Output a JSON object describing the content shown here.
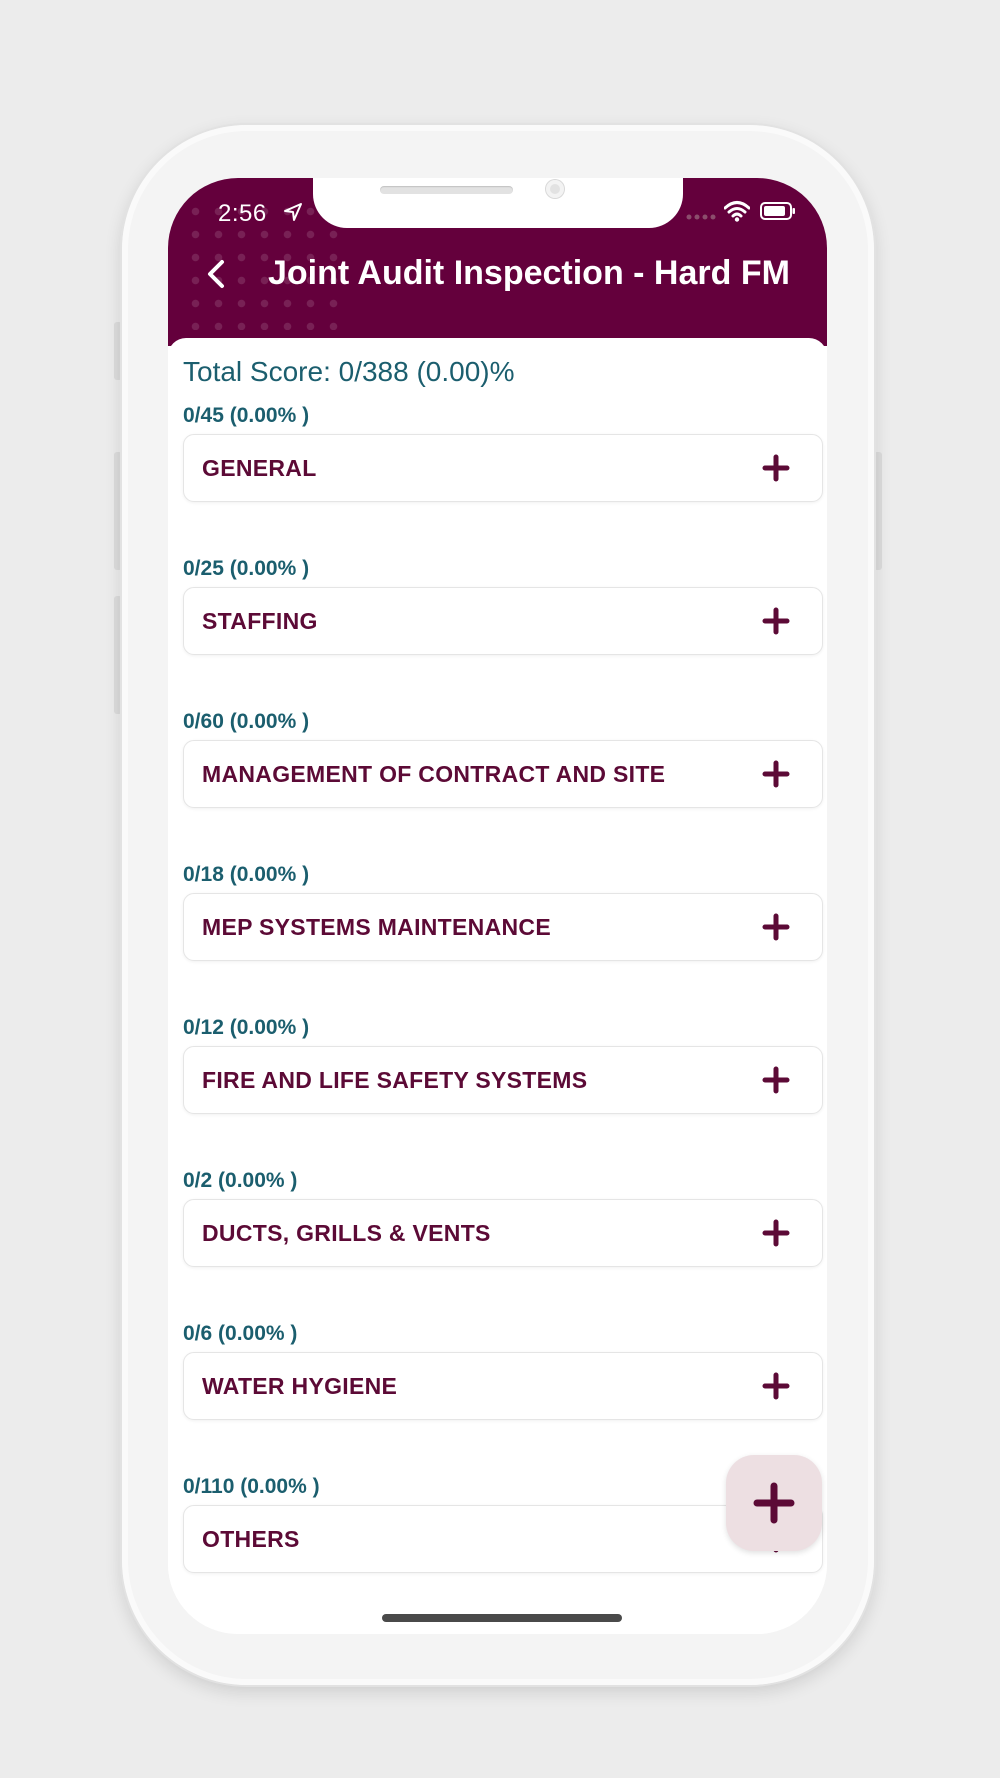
{
  "status_bar": {
    "time": "2:56"
  },
  "header": {
    "back_icon": "chevron-left-icon",
    "title": "Joint Audit Inspection - Hard FM"
  },
  "total_score": "Total Score: 0/388 (0.00)%",
  "sections": [
    {
      "score": "0/45 (0.00% )",
      "title": "GENERAL"
    },
    {
      "score": "0/25 (0.00% )",
      "title": "STAFFING"
    },
    {
      "score": "0/60 (0.00% )",
      "title": "MANAGEMENT OF CONTRACT AND SITE"
    },
    {
      "score": "0/18 (0.00% )",
      "title": "MEP SYSTEMS MAINTENANCE"
    },
    {
      "score": "0/12 (0.00% )",
      "title": "FIRE AND LIFE SAFETY SYSTEMS"
    },
    {
      "score": "0/2 (0.00% )",
      "title": "DUCTS, GRILLS & VENTS"
    },
    {
      "score": "0/6 (0.00% )",
      "title": "WATER HYGIENE"
    },
    {
      "score": "0/110 (0.00% )",
      "title": "OTHERS"
    }
  ],
  "fab": {
    "icon": "plus-icon"
  },
  "colors": {
    "header": "#64003c",
    "score_text": "#1b5e6e",
    "section_title": "#5c0a36",
    "fab_background": "#eddfe2"
  }
}
